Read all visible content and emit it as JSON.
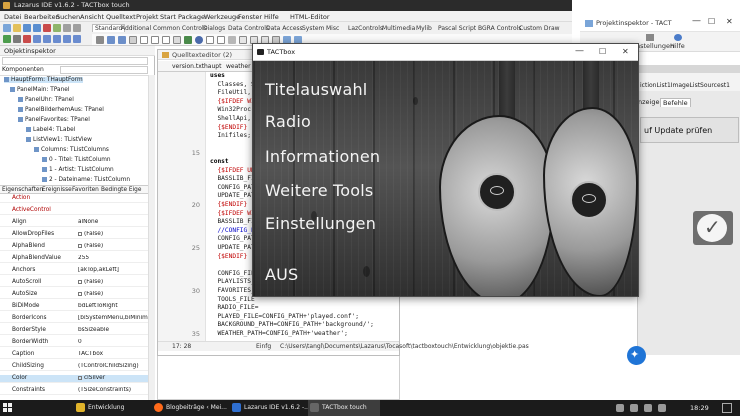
{
  "main_window": {
    "title": "Lazarus IDE v1.6.2 - TACTbox touch",
    "menu": [
      "Datei",
      "Bearbeiten",
      "Suchen",
      "Ansicht",
      "Quelltext",
      "Projekt",
      "Start",
      "Package",
      "Werkzeuge",
      "Fenster",
      "Hilfe",
      "HTML-Editor"
    ],
    "component_tabs": [
      "Standard",
      "Additional",
      "Common Controls",
      "Dialogs",
      "Data Controls",
      "Data Access",
      "System",
      "Misc",
      "LazControls",
      "Multimedia",
      "Mylib",
      "Pascal Script",
      "BGRA Controls",
      "Custom Draw"
    ]
  },
  "object_inspector": {
    "title": "Objektinspektor",
    "components_label": "Komponenten",
    "tree": [
      {
        "label": "HauptForm: THauptForm",
        "selected": true
      },
      {
        "label": "PanelMain: TPanel"
      },
      {
        "label": "PanelUhr: TPanel"
      },
      {
        "label": "PanelBilderhemAus: TPanel"
      },
      {
        "label": "PanelFavorites: TPanel"
      },
      {
        "label": "Label4: TLabel"
      },
      {
        "label": "ListView1: TListView"
      },
      {
        "label": "Columns: TListColumns"
      },
      {
        "label": "0 - Titel: TListColumn"
      },
      {
        "label": "1 - Artist: TListColumn"
      },
      {
        "label": "2 - Dateiname: TListColumn"
      }
    ],
    "tabs": [
      "Eigenschaften",
      "Ereignisse",
      "Favoriten",
      "Bedingte Eige"
    ],
    "properties": [
      {
        "name": "Action",
        "value": "",
        "red": true
      },
      {
        "name": "ActiveControl",
        "value": "",
        "red": true
      },
      {
        "name": "Align",
        "value": "alNone"
      },
      {
        "name": "AllowDropFiles",
        "value": "(False)",
        "check": true
      },
      {
        "name": "AlphaBlend",
        "value": "(False)",
        "check": true
      },
      {
        "name": "AlphaBlendValue",
        "value": "255"
      },
      {
        "name": "Anchors",
        "value": "[akTop,akLeft]"
      },
      {
        "name": "AutoScroll",
        "value": "(False)",
        "check": true
      },
      {
        "name": "AutoSize",
        "value": "(False)",
        "check": true
      },
      {
        "name": "BiDiMode",
        "value": "bdLeftToRight"
      },
      {
        "name": "BorderIcons",
        "value": "[biSystemMenu,biMinimize"
      },
      {
        "name": "BorderStyle",
        "value": "bsSizeable"
      },
      {
        "name": "BorderWidth",
        "value": "0"
      },
      {
        "name": "Caption",
        "value": "TACTbox"
      },
      {
        "name": "ChildSizing",
        "value": "(TControlChildSizing)"
      },
      {
        "name": "Color",
        "value": "clSilver",
        "check": true,
        "highlight": true
      },
      {
        "name": "Constraints",
        "value": "(TSizeConstraints)"
      }
    ]
  },
  "source_editor": {
    "title": "Quelltexteditor (2)",
    "tabs": [
      "version.txt",
      "haupt",
      "weather"
    ],
    "lines": [
      {
        "num": "",
        "text": "uses",
        "cls": "kw"
      },
      {
        "num": "",
        "text": "  Classes, Sy",
        "cls": ""
      },
      {
        "num": "",
        "text": "  FileUtil,",
        "cls": ""
      },
      {
        "num": "",
        "text": "  {$IFDEF WIN",
        "cls": "dir"
      },
      {
        "num": "",
        "text": "  Win32Proc,",
        "cls": ""
      },
      {
        "num": "",
        "text": "  ShellApi,",
        "cls": ""
      },
      {
        "num": "",
        "text": "  {$ENDIF}",
        "cls": "dir"
      },
      {
        "num": "",
        "text": "  Inifiles;",
        "cls": ""
      },
      {
        "num": "",
        "text": "",
        "cls": ""
      },
      {
        "num": "15",
        "text": "",
        "cls": ""
      },
      {
        "num": "",
        "text": "const",
        "cls": "kw"
      },
      {
        "num": "",
        "text": "  {$IFDEF UNI",
        "cls": "dir"
      },
      {
        "num": "",
        "text": "  BASSLIB_FIL",
        "cls": ""
      },
      {
        "num": "",
        "text": "  CONFIG_PATH",
        "cls": ""
      },
      {
        "num": "",
        "text": "  UPDATE_PATH",
        "cls": ""
      },
      {
        "num": "20",
        "text": "  {$ENDIF}",
        "cls": "dir"
      },
      {
        "num": "",
        "text": "  {$IFDEF WIN",
        "cls": "dir"
      },
      {
        "num": "",
        "text": "  BASSLIB_FIL",
        "cls": ""
      },
      {
        "num": "",
        "text": "  //CONFIG_PA",
        "cls": "cmt"
      },
      {
        "num": "",
        "text": "  CONFIG_PATH",
        "cls": ""
      },
      {
        "num": "25",
        "text": "  UPDATE_PATH",
        "cls": ""
      },
      {
        "num": "",
        "text": "  {$ENDIF}",
        "cls": "dir"
      },
      {
        "num": "",
        "text": "",
        "cls": ""
      },
      {
        "num": "",
        "text": "  CONFIG_FILE",
        "cls": ""
      },
      {
        "num": "",
        "text": "  PLAYLISTS_P",
        "cls": ""
      },
      {
        "num": "30",
        "text": "  FAVORITES_P",
        "cls": ""
      },
      {
        "num": "",
        "text": "  TOOLS_FILE",
        "cls": ""
      },
      {
        "num": "",
        "text": "  RADIO_FILE=",
        "cls": ""
      },
      {
        "num": "",
        "text": "  PLAYED_FILE=CONFIG_PATH+'played.conf';",
        "cls": "str"
      },
      {
        "num": "",
        "text": "  BACKGROUND_PATH=CONFIG_PATH+'background/';",
        "cls": "str"
      },
      {
        "num": "35",
        "text": "  WEATHER_PATH=CONFIG_PATH+'weather';",
        "cls": "str"
      }
    ],
    "status_pos": "17: 28",
    "status_mode": "Einfg",
    "status_path": "C:\\Users\\tangl\\Documents\\Lazarus\\Tocasoft\\tactboxtouch\\Entwicklung\\objektie.pas"
  },
  "project_inspector": {
    "title": "Projektinspektor - TACT",
    "toolbar": [
      "nstellungen",
      "Hilfe"
    ],
    "form_strip": "ictionList1ImageListSourcest1",
    "tabs": [
      "nzeige",
      "Befehle"
    ],
    "active_tab": "Befehle",
    "update_button": "uf Update prüfen",
    "check_glyph": "✓",
    "globe_glyph": "✦"
  },
  "tactbox": {
    "title": "TACTbox",
    "menu_items": [
      "Titelauswahl",
      "Radio",
      "Informationen",
      "Weitere Tools",
      "Einstellungen",
      "AUS"
    ],
    "controls": {
      "minimize": "—",
      "maximize": "☐",
      "close": "✕"
    }
  },
  "taskbar": {
    "items": [
      {
        "label": "Entwicklung",
        "color": "#e0b32a"
      },
      {
        "label": "Blogbeiträge ‹ Mei...",
        "color": "#ff6a1a"
      },
      {
        "label": "Lazarus IDE v1.6.2 -...",
        "color": "#2f6fd0"
      },
      {
        "label": "TACTbox touch",
        "color": "#333333"
      }
    ],
    "clock": "18:29"
  },
  "colors": {
    "title_dark": "#2b2b2b",
    "selection": "#cce4f7",
    "directive_red": "#c00000",
    "comment_blue": "#0000c8",
    "taskbar": "#1b1b1b"
  }
}
